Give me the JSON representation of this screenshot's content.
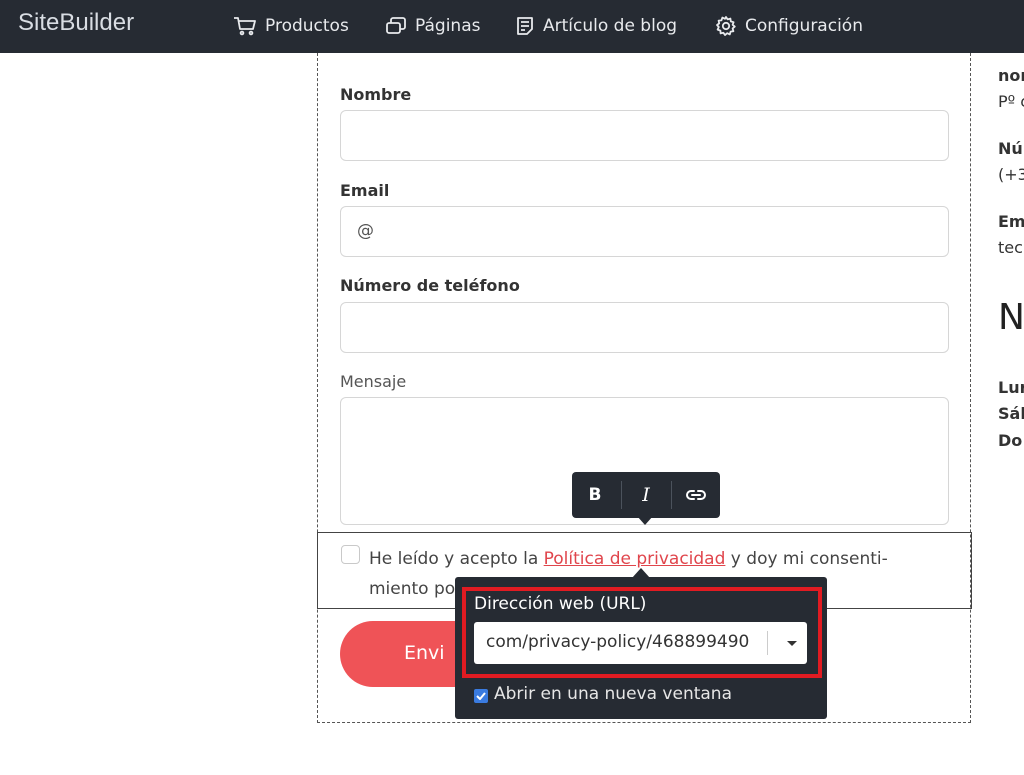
{
  "app": {
    "brand": "SiteBuilder"
  },
  "nav": {
    "items": [
      {
        "label": "Productos",
        "icon": "cart-icon"
      },
      {
        "label": "Páginas",
        "icon": "pages-icon"
      },
      {
        "label": "Artículo de blog",
        "icon": "blog-icon"
      },
      {
        "label": "Configuración",
        "icon": "gear-icon"
      }
    ]
  },
  "form": {
    "name_label": "Nombre",
    "email_label": "Email",
    "email_prefix": "@",
    "phone_label": "Número de teléfono",
    "message_label": "Mensaje",
    "consent_before": "He leído y acepto la ",
    "consent_link": "Política de privacidad",
    "consent_after_line1": " y doy mi consenti-",
    "consent_line2": "miento po",
    "send_label": "Envi"
  },
  "format_toolbar": {
    "bold": "B",
    "italic": "I"
  },
  "link_panel": {
    "url_label": "Dirección web (URL)",
    "url_value": "com/privacy-policy/468899490",
    "new_window_label": "Abrir en una nueva ventana",
    "new_window_checked": true
  },
  "sidebar_info": {
    "line1": "nor",
    "line2": "Pº c",
    "line3": "Nú",
    "line4": "(+3",
    "line5": "Em",
    "line6": "tec",
    "heading": "N",
    "day1": "Lur",
    "day2": "Sál",
    "day3": "Do"
  },
  "colors": {
    "topbar": "#262b33",
    "accent": "#ef5357",
    "highlight": "#e11b22",
    "link": "#e0454c"
  }
}
